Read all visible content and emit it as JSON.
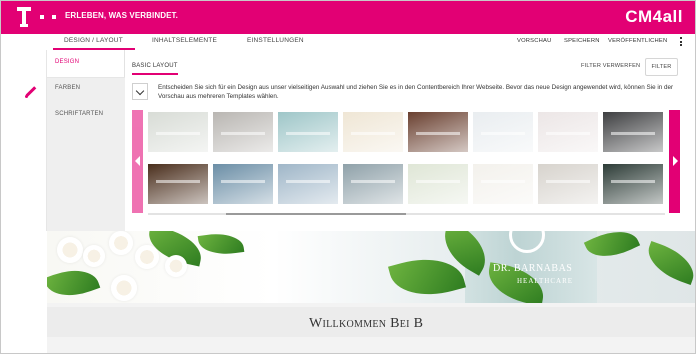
{
  "header": {
    "slogan": "ERLEBEN, WAS VERBINDET.",
    "brand": "CM4all",
    "accent_color": "#e20074"
  },
  "tabs": [
    {
      "label": "DESIGN / LAYOUT",
      "active": true
    },
    {
      "label": "INHALTSELEMENTE",
      "active": false
    },
    {
      "label": "EINSTELLUNGEN",
      "active": false
    }
  ],
  "actions": {
    "preview": "VORSCHAU",
    "save": "SPEICHERN",
    "publish": "VERÖFFENTLICHEN",
    "more_icon": "kebab-icon"
  },
  "sidebar": {
    "items": [
      {
        "label": "DESIGN",
        "active": true
      },
      {
        "label": "FARBEN",
        "active": false
      },
      {
        "label": "SCHRIFTARTEN",
        "active": false
      }
    ]
  },
  "main": {
    "section_tab": "BASIC LAYOUT",
    "filter_reset": "FILTER VERWERFEN",
    "filter": "FILTER",
    "description": "Entscheiden Sie sich für ein Design aus unser vielseitigen Auswahl und ziehen Sie es in den Contentbereich Ihrer Webseite. Bevor das neue Design angewendet wird, können Sie in der Vorschau aus mehreren Templates wählen."
  },
  "templates": {
    "row1": [
      "#d8dcd6",
      "#b9b6b2",
      "#9ec6c8",
      "#efe6d5",
      "#6a4030",
      "#e9edf0",
      "#ece6e6",
      "#3e3f41"
    ],
    "row2": [
      "#4a2e1c",
      "#6b8ea6",
      "#9fb6c8",
      "#8fa1a9",
      "#dfe6d6",
      "#f3f1ec",
      "#d7d3cd",
      "#2d3c37"
    ]
  },
  "preview": {
    "bottle_line1": "DR. BARNABAS",
    "bottle_line2": "HEALTHCARE",
    "welcome": "Willkommen Bei B"
  }
}
